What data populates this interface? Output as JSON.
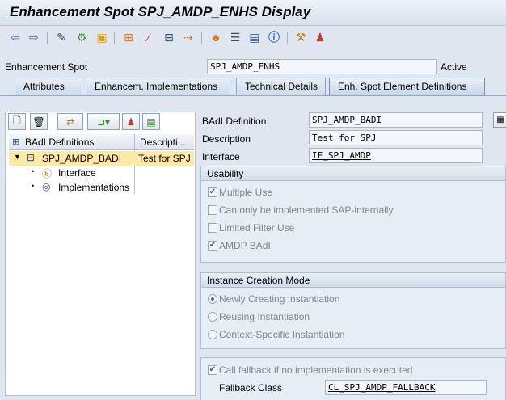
{
  "window": {
    "title": "Enhancement Spot SPJ_AMDP_ENHS Display"
  },
  "toolbar": {
    "icons": [
      "back-icon",
      "forward-icon",
      "display-change-icon",
      "other-object-icon",
      "activate-icon",
      "check-icon",
      "magic-wand-icon",
      "where-used-icon",
      "navigate-icon",
      "hierarchy-icon",
      "align-icon",
      "display-object-list-icon",
      "info-icon",
      "tools-icon",
      "users-icon"
    ]
  },
  "header": {
    "label": "Enhancement Spot",
    "value": "SPJ_AMDP_ENHS",
    "status": "Active"
  },
  "tabs": [
    {
      "label": "Attributes"
    },
    {
      "label": "Enhancem. Implementations"
    },
    {
      "label": "Technical Details"
    },
    {
      "label": "Enh. Spot Element Definitions"
    }
  ],
  "tree": {
    "columns": [
      "BAdI Definitions",
      "Descripti..."
    ],
    "rows": [
      {
        "label": "SPJ_AMDP_BADI",
        "description": "Test for SPJ"
      },
      {
        "label": "Interface",
        "description": ""
      },
      {
        "label": "Implementations",
        "description": ""
      }
    ]
  },
  "detail": {
    "badi_label": "BAdI Definition",
    "badi_value": "SPJ_AMDP_BADI",
    "desc_label": "Description",
    "desc_value": "Test for SPJ",
    "iface_label": "Interface",
    "iface_value": "IF_SPJ_AMDP"
  },
  "usability": {
    "title": "Usability",
    "options": [
      {
        "label": "Multiple Use",
        "checked": true
      },
      {
        "label": "Can only be implemented SAP-internally",
        "checked": false
      },
      {
        "label": "Limited Filter Use",
        "checked": false
      },
      {
        "label": "AMDP BAdI",
        "checked": true
      }
    ]
  },
  "instance": {
    "title": "Instance Creation Mode",
    "options": [
      {
        "label": "Newly Creating Instantiation",
        "selected": true
      },
      {
        "label": "Reusing Instantiation",
        "selected": false
      },
      {
        "label": "Context-Specific Instantiation",
        "selected": false
      }
    ]
  },
  "fallback": {
    "call_label": "Call fallback if no implementation is executed",
    "call_checked": true,
    "class_label": "Fallback Class",
    "class_value": "CL_SPJ_AMDP_FALLBACK"
  }
}
